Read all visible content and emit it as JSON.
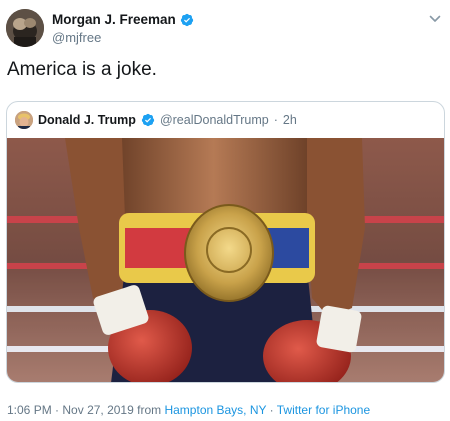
{
  "author": {
    "name": "Morgan J. Freeman",
    "handle": "@mjfree",
    "verified": true
  },
  "tweet": {
    "text": "America is a joke."
  },
  "quoted_tweet": {
    "name": "Donald J. Trump",
    "handle": "@realDonaldTrump",
    "separator": "·",
    "time": "2h",
    "verified": true,
    "image_description_icon": "boxer-image"
  },
  "footer": {
    "time": "1:06 PM",
    "separator": "·",
    "date": "Nov 27, 2019",
    "from_word": "from",
    "location": "Hampton Bays, NY",
    "source": "Twitter for iPhone"
  },
  "colors": {
    "verified_blue": "#1da1f2",
    "link_blue": "#1b95e0",
    "muted_text": "#657786"
  },
  "icons": {
    "verified": "verified-badge-icon",
    "menu": "chevron-down-icon"
  }
}
